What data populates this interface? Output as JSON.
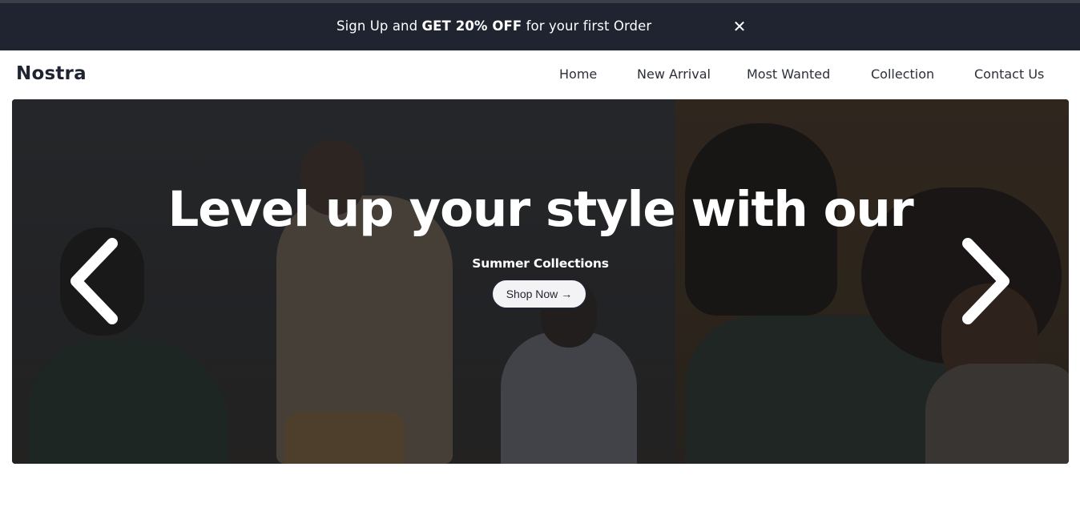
{
  "promo": {
    "text_before": "Sign Up and ",
    "text_bold": "GET 20% OFF",
    "text_after": " for your first Order",
    "close_glyph": "✕"
  },
  "brand": {
    "name": "Nostra"
  },
  "nav": {
    "items": [
      {
        "label": "Home"
      },
      {
        "label": "New Arrival"
      },
      {
        "label": "Most Wanted"
      },
      {
        "label": "Collection"
      },
      {
        "label": "Contact Us"
      }
    ]
  },
  "hero": {
    "title": "Level up your style with our",
    "subtitle": "Summer Collections",
    "cta_label": "Shop Now",
    "cta_icon": "→",
    "prev_icon": "chevron-left-icon",
    "next_icon": "chevron-right-icon"
  },
  "colors": {
    "dark": "#1f2430",
    "white": "#ffffff"
  }
}
